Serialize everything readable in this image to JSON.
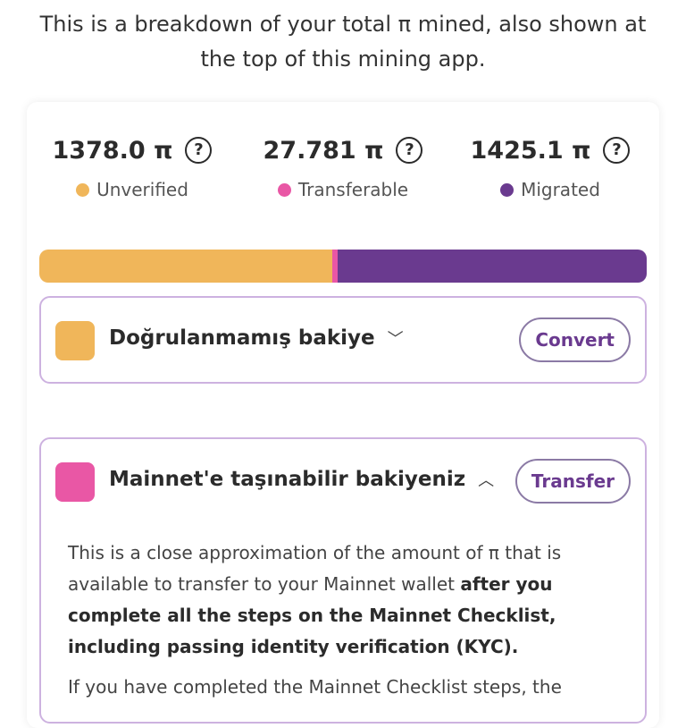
{
  "intro": "This is a breakdown of your total π mined, also shown at the top of this mining app.",
  "stats": [
    {
      "amount": "1378.0 π",
      "label": "Unverified",
      "color": "#f0b65a"
    },
    {
      "amount": "27.781 π",
      "label": "Transferable",
      "color": "#e957a5"
    },
    {
      "amount": "1425.1 π",
      "label": "Migrated",
      "color": "#6a3a8f"
    }
  ],
  "help_icon_glyph": "?",
  "progress": {
    "unverified_fraction": 0.4819,
    "transferable_fraction": 0.0097,
    "migrated_fraction": 0.4984
  },
  "panels": {
    "unverified": {
      "title": "Doğrulanmamış bakiye",
      "chevron": "﹀",
      "button": "Convert",
      "color": "#f0b65a"
    },
    "transferable": {
      "title": "Mainnet'e taşınabilir bakiyeniz",
      "chevron": "︿",
      "button": "Transfer",
      "color": "#e957a5",
      "body_plain": "This is a close approximation of the amount of π that is available to transfer to your Mainnet wallet ",
      "body_bold": "after you complete all the steps on the Mainnet Checklist, including passing identity verification (KYC).",
      "body_cutoff": "If you have completed the Mainnet Checklist steps, the"
    }
  }
}
